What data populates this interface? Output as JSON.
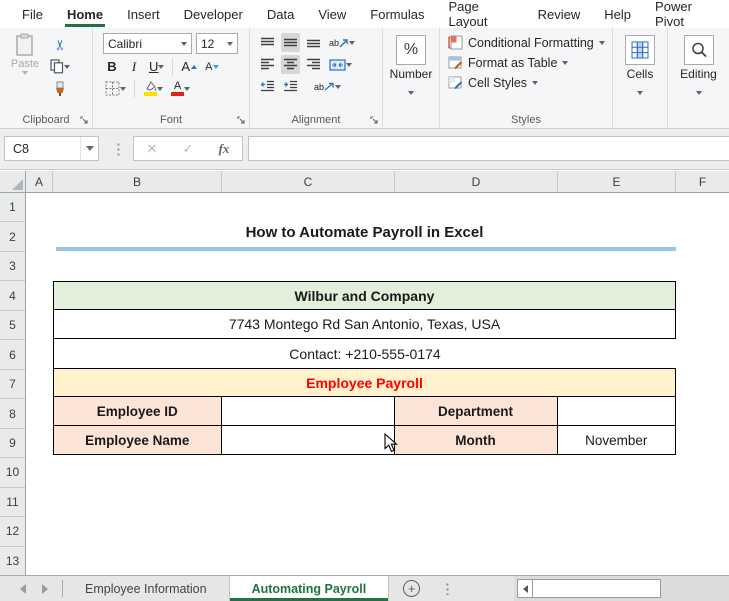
{
  "menu": {
    "tabs": [
      {
        "label": "File"
      },
      {
        "label": "Home"
      },
      {
        "label": "Insert"
      },
      {
        "label": "Developer"
      },
      {
        "label": "Data"
      },
      {
        "label": "View"
      },
      {
        "label": "Formulas"
      },
      {
        "label": "Page Layout"
      },
      {
        "label": "Review"
      },
      {
        "label": "Help"
      },
      {
        "label": "Power Pivot"
      }
    ],
    "active_tab": "Home"
  },
  "ribbon": {
    "clipboard": {
      "label": "Clipboard",
      "paste": "Paste"
    },
    "font": {
      "label": "Font",
      "name": "Calibri",
      "size": "12",
      "bold": "B",
      "italic": "I",
      "underline": "U",
      "grow": "A",
      "shrink": "A",
      "color_letter": "A"
    },
    "alignment": {
      "label": "Alignment",
      "ab1": "ab",
      "ab2": "ab"
    },
    "number": {
      "label": "Number",
      "percent": "%"
    },
    "styles": {
      "label": "Styles",
      "conditional_formatting": "Conditional Formatting",
      "format_as_table": "Format as Table",
      "cell_styles": "Cell Styles"
    },
    "cells": {
      "label": "Cells"
    },
    "editing": {
      "label": "Editing"
    }
  },
  "formula_bar": {
    "name_box": "C8",
    "cancel": "✕",
    "enter": "✓",
    "fx": "fx",
    "value": ""
  },
  "grid": {
    "columns": [
      "A",
      "B",
      "C",
      "D",
      "E",
      "F"
    ],
    "rows": [
      "1",
      "2",
      "3",
      "4",
      "5",
      "6",
      "7",
      "8",
      "9",
      "10",
      "11",
      "12",
      "13"
    ],
    "title": "How to Automate Payroll in Excel",
    "table": {
      "company": "Wilbur and Company",
      "address": "7743 Montego Rd San Antonio, Texas, USA",
      "contact": "Contact: +210-555-0174",
      "section_header": "Employee Payroll",
      "row8": {
        "label_left": "Employee ID",
        "value_left": "",
        "label_right": "Department",
        "value_right": ""
      },
      "row9": {
        "label_left": "Employee Name",
        "value_left": "",
        "label_right": "Month",
        "value_right": "November"
      }
    },
    "colors": {
      "company_fill": "#E2EFDA",
      "payroll_fill": "#FFF2CC",
      "label_fill": "#FCE4D6",
      "payroll_text": "#FF0000",
      "title_rule": "#9DC3E6",
      "excel_green": "#217346"
    }
  },
  "sheet_tabs": {
    "tabs": [
      {
        "label": "Employee Information",
        "active": false
      },
      {
        "label": "Automating Payroll",
        "active": true
      }
    ],
    "add_label": "+"
  }
}
